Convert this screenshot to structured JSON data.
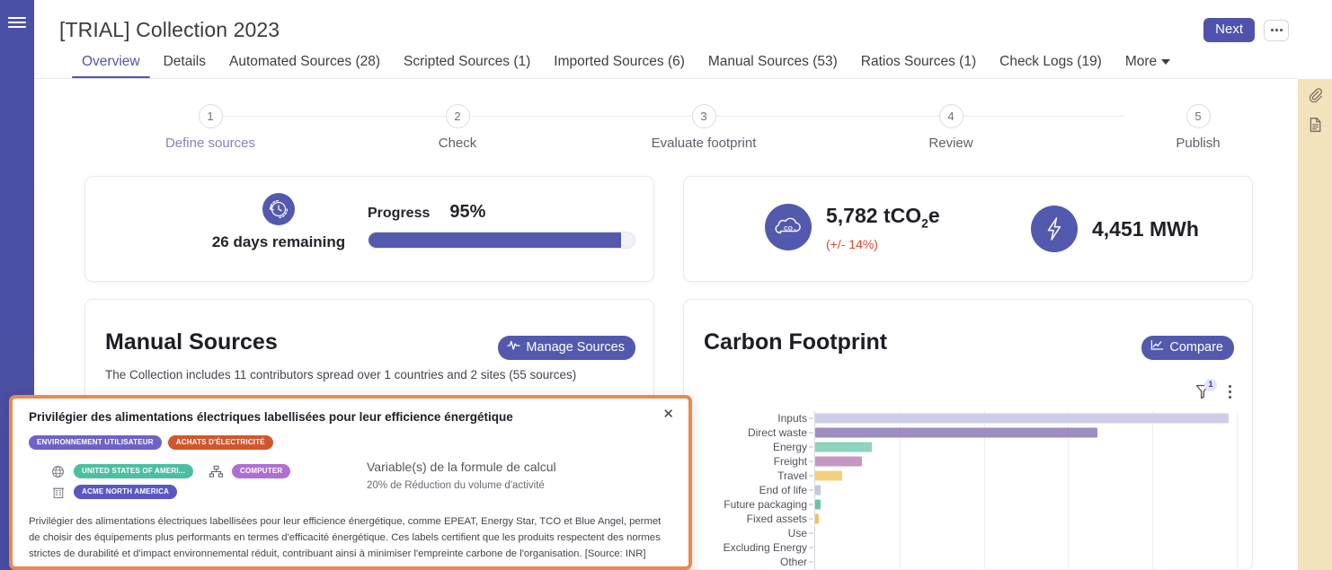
{
  "app": {
    "title": "[TRIAL] Collection 2023",
    "accent": "#4f53ad",
    "orange": "#e98a4e",
    "menu_icon": "hamburger-list-icon"
  },
  "header": {
    "next_label": "Next",
    "more_menu_icon": "ellipsis-icon"
  },
  "tabs": [
    {
      "label": "Overview",
      "active": true
    },
    {
      "label": "Details",
      "active": false
    },
    {
      "label": "Automated Sources (28)",
      "active": false
    },
    {
      "label": "Scripted Sources (1)",
      "active": false
    },
    {
      "label": "Imported Sources (6)",
      "active": false
    },
    {
      "label": "Manual Sources (53)",
      "active": false
    },
    {
      "label": "Ratios Sources (1)",
      "active": false
    },
    {
      "label": "Check Logs (19)",
      "active": false
    },
    {
      "label": "More",
      "active": false,
      "caret": true
    }
  ],
  "stepper": {
    "steps": [
      {
        "number": "1",
        "label": "Define sources",
        "current": true
      },
      {
        "number": "2",
        "label": "Check",
        "current": false
      },
      {
        "number": "3",
        "label": "Evaluate footprint",
        "current": false
      },
      {
        "number": "4",
        "label": "Review",
        "current": false
      },
      {
        "number": "5",
        "label": "Publish",
        "current": false
      }
    ]
  },
  "progress_card": {
    "clock_icon": "clock-refresh-icon",
    "days_remaining": "26 days remaining",
    "progress_label": "Progress",
    "progress_value": "95%",
    "progress_percent": 95
  },
  "metrics_card": {
    "co2": {
      "icon": "co2-cloud-icon",
      "value_pre": "5,782 tCO",
      "value_sub": "2",
      "value_post": "e",
      "uncertainty": "(+/- 14%)",
      "uncertainty_color": "#e0462f"
    },
    "energy": {
      "icon": "lightning-bolt-icon",
      "value": "4,451 MWh"
    }
  },
  "manual_sources": {
    "title": "Manual Sources",
    "button_label": "Manage Sources",
    "button_icon": "activity-pulse-icon",
    "subtitle": "The Collection includes 11 contributors spread over 1 countries and 2 sites (55 sources)"
  },
  "carbon_footprint": {
    "title": "Carbon Footprint",
    "button_label": "Compare",
    "button_icon": "line-chart-icon",
    "filter_icon": "funnel-filter-icon",
    "filter_badge": "1",
    "kebab_icon": "vertical-ellipsis-icon"
  },
  "chart_data": {
    "type": "bar",
    "orientation": "horizontal",
    "title": "Carbon Footprint",
    "xlabel": "",
    "ylabel": "",
    "categories": [
      "Inputs",
      "Direct waste",
      "Energy",
      "Freight",
      "Travel",
      "End of life",
      "Future packaging",
      "Fixed assets",
      "Use",
      "Excluding Energy",
      "Other"
    ],
    "values": [
      98,
      67,
      13.5,
      11,
      6.5,
      1.3,
      1.2,
      0.9,
      0,
      0,
      0
    ],
    "colors": [
      "#cfcce8",
      "#9e8dc0",
      "#8ed2c2",
      "#c596c4",
      "#f1d17c",
      "#bfc6dd",
      "#6cc4aa",
      "#efc06a",
      "#cfcce8",
      "#cfcce8",
      "#cfcce8"
    ],
    "xlim": [
      0,
      100
    ],
    "gridlines": [
      20,
      40,
      60,
      80,
      100
    ],
    "grid": true,
    "legend": false
  },
  "popup": {
    "title": "Privilégier des alimentations électriques labellisées pour leur efficience énergétique",
    "close_icon": "close-x-icon",
    "tags": [
      {
        "label": "ENVIRONNEMENT UTILISATEUR",
        "color": "#6d63c6"
      },
      {
        "label": "ACHATS D'ÉLECTRICITÉ",
        "color": "#d2562c"
      }
    ],
    "attributes": [
      {
        "icon": "globe-icon",
        "label": "UNITED STATES OF AMERI...",
        "color": "#4cbfa2"
      },
      {
        "icon": "building-icon",
        "label": "ACME NORTH AMERICA",
        "color": "#5a57c4"
      }
    ],
    "attributes2": [
      {
        "icon": "computer-network-icon",
        "label": "COMPUTER",
        "color": "#b06fd0"
      }
    ],
    "formula": {
      "title": "Variable(s) de la formule de calcul",
      "value": "20% de Réduction du volume d'activité"
    },
    "body": "Privilégier des alimentations électriques labellisées pour leur efficience énergétique, comme EPEAT, Energy Star, TCO et Blue Angel, permet de choisir des équipements plus performants en termes d'efficacité énergétique. Ces labels certifient que les produits respectent des normes strictes de durabilité et d'impact environnemental réduit, contribuant ainsi à minimiser l'empreinte carbone de l'organisation. [Source: INR]"
  },
  "right_rail": {
    "items": [
      {
        "icon": "paperclip-icon"
      },
      {
        "icon": "document-icon"
      }
    ]
  }
}
